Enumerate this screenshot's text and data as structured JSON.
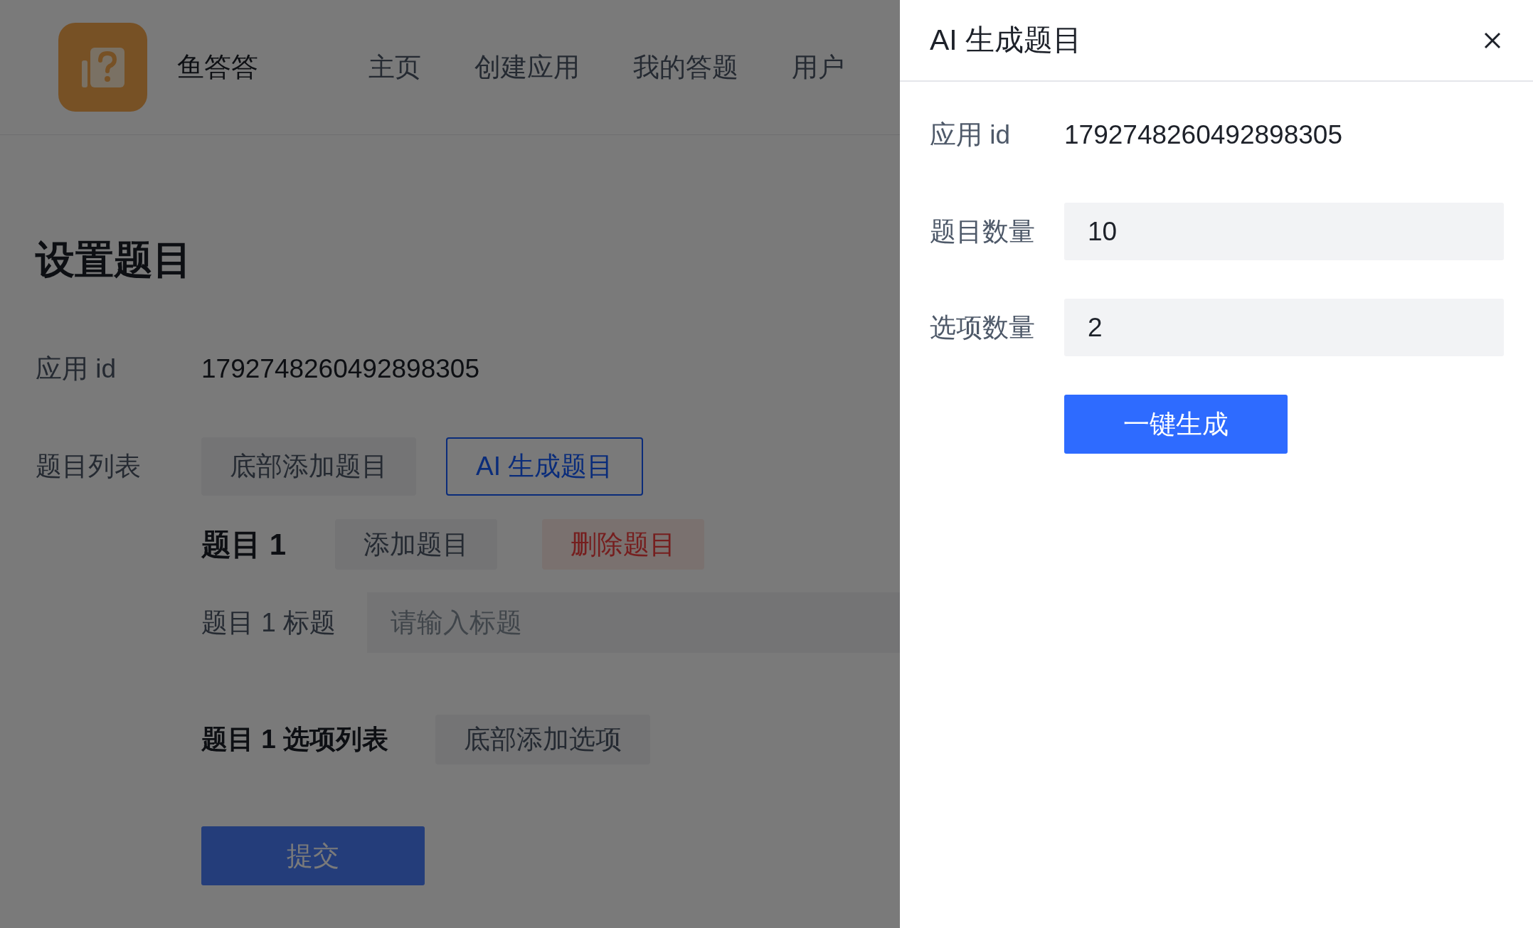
{
  "header": {
    "app_name": "鱼答答",
    "nav": [
      {
        "label": "主页"
      },
      {
        "label": "创建应用"
      },
      {
        "label": "我的答题"
      },
      {
        "label": "用户"
      }
    ]
  },
  "page": {
    "title": "设置题目",
    "app_id": {
      "label": "应用 id",
      "value": "1792748260492898305"
    },
    "question_list": {
      "label": "题目列表",
      "buttons": [
        {
          "label": "底部添加题目",
          "kind": "secondary"
        },
        {
          "label": "AI 生成题目",
          "kind": "outline"
        }
      ]
    },
    "questions": [
      {
        "title": "题目 1",
        "actions": [
          {
            "label": "添加题目",
            "kind": "secondary"
          },
          {
            "label": "删除题目",
            "kind": "danger"
          }
        ],
        "title_field": {
          "label": "题目 1 标题",
          "placeholder": "请输入标题"
        },
        "options_heading": "题目 1 选项列表",
        "options_action": {
          "label": "底部添加选项",
          "kind": "secondary"
        }
      }
    ],
    "submit": "提交"
  },
  "drawer": {
    "title": "AI 生成题目",
    "fields": [
      {
        "label": "应用 id",
        "value": "1792748260492898305",
        "kind": "text"
      },
      {
        "label": "题目数量",
        "value": "10",
        "kind": "input"
      },
      {
        "label": "选项数量",
        "value": "2",
        "kind": "input"
      }
    ],
    "button": "一键生成"
  }
}
